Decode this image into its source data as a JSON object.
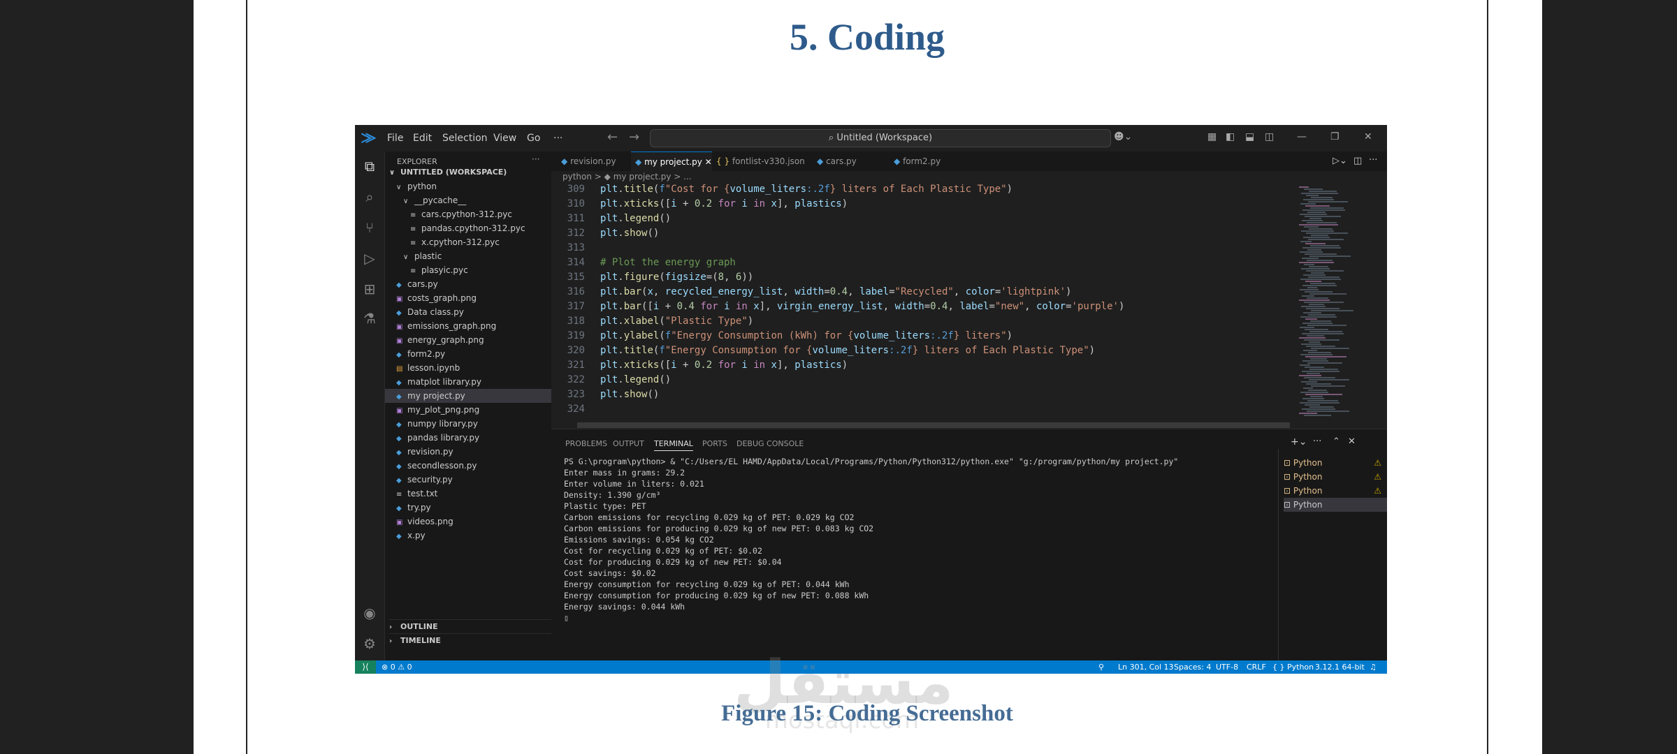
{
  "doc": {
    "heading": "5. Coding",
    "caption": "Figure 15: Coding Screenshot",
    "watermark": "مستقل",
    "watermark_sub": "mostaql.com"
  },
  "titlebar": {
    "menus": [
      "File",
      "Edit",
      "Selection",
      "View",
      "Go",
      "···"
    ],
    "command_center": "Untitled (Workspace)"
  },
  "explorer": {
    "header": "EXPLORER",
    "workspace": "UNTITLED (WORKSPACE)",
    "items": [
      {
        "label": "python",
        "icon": "∨",
        "kind": "folder"
      },
      {
        "label": "__pycache__",
        "icon": "∨",
        "kind": "folder"
      },
      {
        "label": "cars.cpython-312.pyc",
        "icon": "≡",
        "kind": "pyc"
      },
      {
        "label": "pandas.cpython-312.pyc",
        "icon": "≡",
        "kind": "pyc"
      },
      {
        "label": "x.cpython-312.pyc",
        "icon": "≡",
        "kind": "pyc"
      },
      {
        "label": "plastic",
        "icon": "∨",
        "kind": "folder"
      },
      {
        "label": "plasyic.pyc",
        "icon": "≡",
        "kind": "pyc"
      },
      {
        "label": "cars.py",
        "icon": "◆",
        "kind": "py"
      },
      {
        "label": "costs_graph.png",
        "icon": "▣",
        "kind": "png"
      },
      {
        "label": "Data class.py",
        "icon": "◆",
        "kind": "py"
      },
      {
        "label": "emissions_graph.png",
        "icon": "▣",
        "kind": "png"
      },
      {
        "label": "energy_graph.png",
        "icon": "▣",
        "kind": "png"
      },
      {
        "label": "form2.py",
        "icon": "◆",
        "kind": "py"
      },
      {
        "label": "lesson.ipynb",
        "icon": "▤",
        "kind": "nb"
      },
      {
        "label": "matplot library.py",
        "icon": "◆",
        "kind": "py"
      },
      {
        "label": "my project.py",
        "icon": "◆",
        "kind": "py"
      },
      {
        "label": "my_plot_png.png",
        "icon": "▣",
        "kind": "png"
      },
      {
        "label": "numpy library.py",
        "icon": "◆",
        "kind": "py"
      },
      {
        "label": "pandas library.py",
        "icon": "◆",
        "kind": "py"
      },
      {
        "label": "revision.py",
        "icon": "◆",
        "kind": "py"
      },
      {
        "label": "secondlesson.py",
        "icon": "◆",
        "kind": "py"
      },
      {
        "label": "security.py",
        "icon": "◆",
        "kind": "py"
      },
      {
        "label": "test.txt",
        "icon": "≡",
        "kind": "txt"
      },
      {
        "label": "try.py",
        "icon": "◆",
        "kind": "py"
      },
      {
        "label": "videos.png",
        "icon": "▣",
        "kind": "png"
      },
      {
        "label": "x.py",
        "icon": "◆",
        "kind": "py"
      }
    ],
    "outline": "OUTLINE",
    "timeline": "TIMELINE"
  },
  "tabs": [
    {
      "label": "revision.py",
      "icon": "◆"
    },
    {
      "label": "my project.py",
      "icon": "◆"
    },
    {
      "label": "fontlist-v330.json",
      "icon": "{ }"
    },
    {
      "label": "cars.py",
      "icon": "◆"
    },
    {
      "label": "form2.py",
      "icon": "◆"
    }
  ],
  "breadcrumb": "python  >  ◆ my project.py  >  ...",
  "editor": {
    "line_numbers": [
      "309",
      "310",
      "311",
      "312",
      "313",
      "314",
      "315",
      "316",
      "317",
      "318",
      "319",
      "320",
      "321",
      "322",
      "323",
      "324"
    ]
  },
  "panel": {
    "tabs": [
      "PROBLEMS",
      "OUTPUT",
      "TERMINAL",
      "PORTS",
      "DEBUG CONSOLE"
    ],
    "terminal_lines": [
      "PS G:\\program\\python> & \"C:/Users/EL HAMD/AppData/Local/Programs/Python/Python312/python.exe\" \"g:/program/python/my project.py\"",
      "Enter mass in grams: 29.2",
      "Enter volume in liters: 0.021",
      "Density: 1.390 g/cm³",
      "Plastic type: PET",
      "Carbon emissions for recycling 0.029 kg of PET: 0.029 kg CO2",
      "Carbon emissions for producing 0.029 kg of new PET: 0.083 kg CO2",
      "Emissions savings: 0.054 kg CO2",
      "Cost for recycling 0.029 kg of PET: $0.02",
      "Cost for producing 0.029 kg of new PET: $0.04",
      "Cost savings: $0.02",
      "Energy consumption for recycling 0.029 kg of PET: 0.044 kWh",
      "Energy consumption for producing 0.029 kg of new PET: 0.088 kWh",
      "Energy savings: 0.044 kWh",
      "▯"
    ],
    "terminals": [
      "Python",
      "Python",
      "Python",
      "Python"
    ]
  },
  "status": {
    "problems": "⊗ 0 ⚠ 0",
    "position": "Ln 301, Col 13",
    "spaces": "Spaces: 4",
    "encoding": "UTF-8",
    "eol": "CRLF",
    "language": "{ } Python",
    "interpreter": "3.12.1 64-bit"
  }
}
